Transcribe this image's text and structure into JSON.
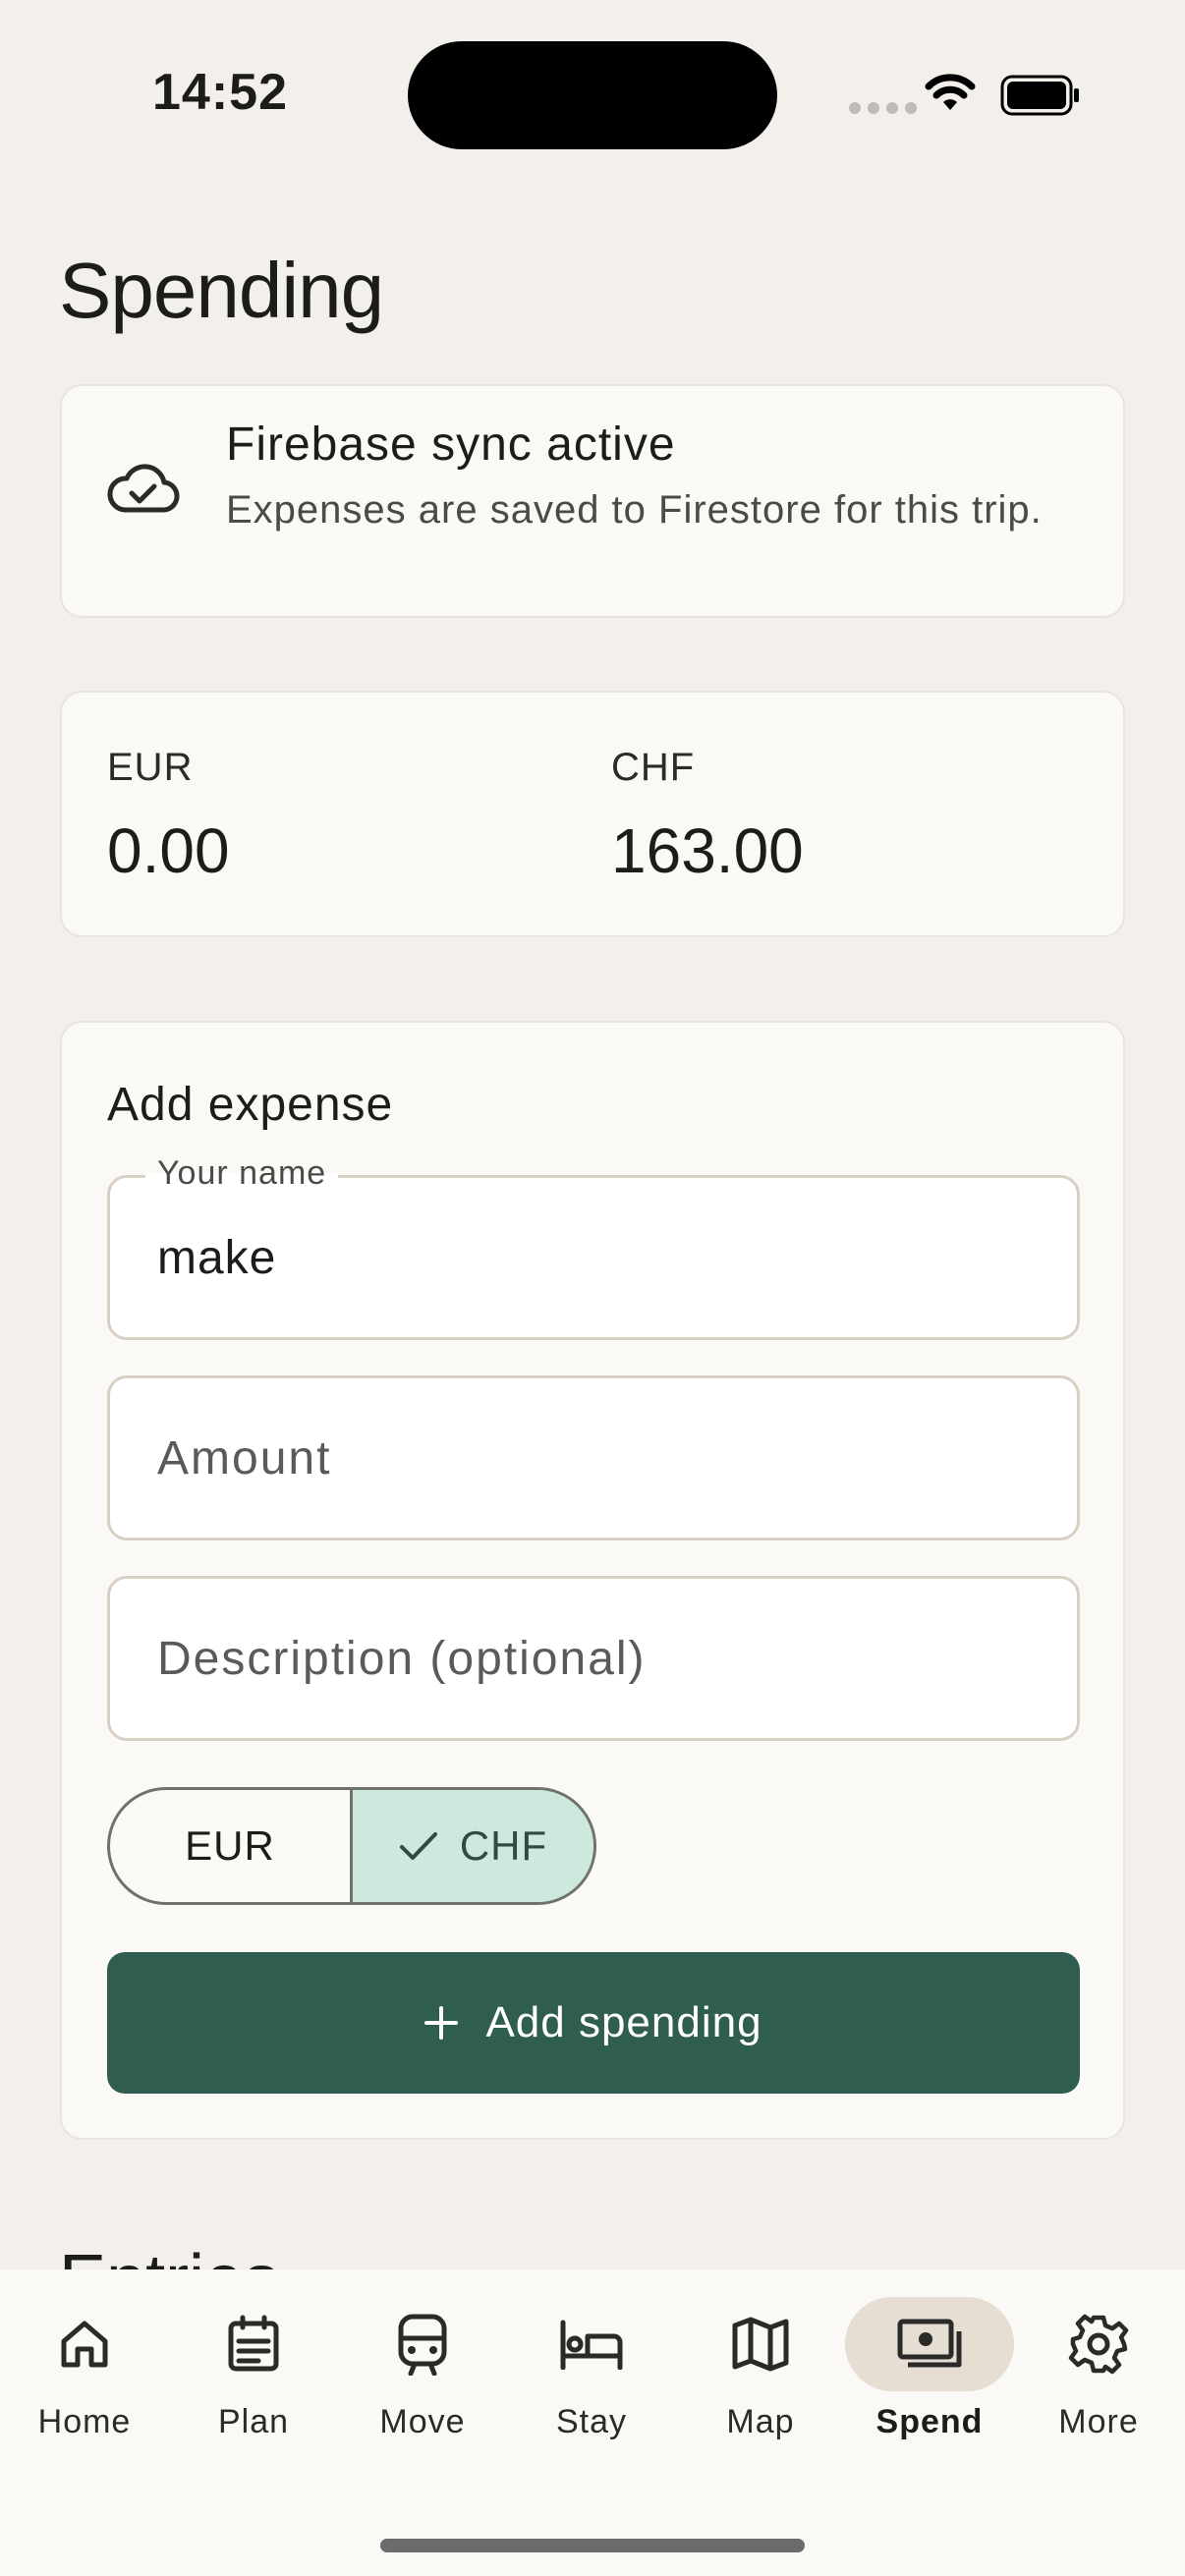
{
  "status_bar": {
    "time": "14:52"
  },
  "page_title": "Spending",
  "sync": {
    "title": "Firebase sync active",
    "description": "Expenses are saved to Firestore for this trip."
  },
  "totals": [
    {
      "currency": "EUR",
      "amount": "0.00"
    },
    {
      "currency": "CHF",
      "amount": "163.00"
    }
  ],
  "form": {
    "title": "Add expense",
    "name_label": "Your name",
    "name_value": "make",
    "amount_placeholder": "Amount",
    "description_placeholder": "Description (optional)",
    "currency_options": [
      "EUR",
      "CHF"
    ],
    "selected_currency": "CHF",
    "submit_label": "Add spending"
  },
  "entries_title": "Entries",
  "tabs": [
    {
      "label": "Home",
      "icon": "home-icon"
    },
    {
      "label": "Plan",
      "icon": "plan-icon"
    },
    {
      "label": "Move",
      "icon": "train-icon"
    },
    {
      "label": "Stay",
      "icon": "bed-icon"
    },
    {
      "label": "Map",
      "icon": "map-icon"
    },
    {
      "label": "Spend",
      "icon": "money-icon",
      "active": true
    },
    {
      "label": "More",
      "icon": "gear-icon"
    }
  ],
  "colors": {
    "background": "#f3f0eb",
    "card": "#faf9f6",
    "accent": "#2f5d50",
    "selected_chip": "#cde8dc",
    "active_tab": "#e6ddd3"
  }
}
